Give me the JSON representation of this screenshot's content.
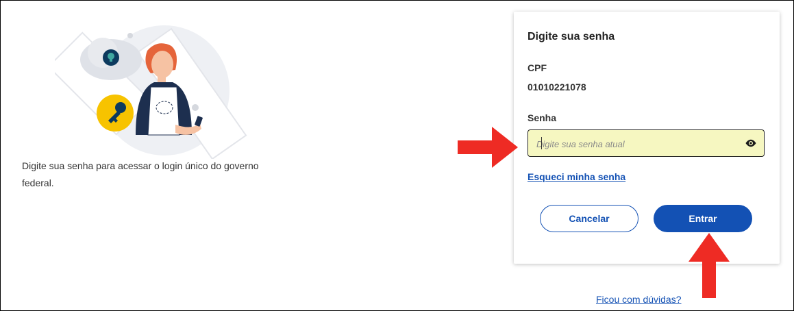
{
  "intro": {
    "description": "Digite sua senha para acessar o login único do governo federal."
  },
  "card": {
    "title": "Digite sua senha",
    "cpf_label": "CPF",
    "cpf_value": "01010221078",
    "password_label": "Senha",
    "password_placeholder": "Digite sua senha atual",
    "password_value": "",
    "forgot_link": "Esqueci minha senha",
    "cancel_label": "Cancelar",
    "enter_label": "Entrar"
  },
  "footer": {
    "help_link": "Ficou com dúvidas?"
  },
  "colors": {
    "primary": "#1351b4",
    "input_bg": "#f6f7c1",
    "annotation_arrow": "#ee2b24",
    "key_badge": "#f7c300"
  },
  "icons": {
    "password_toggle": "eye-icon",
    "illustration_key": "key-icon",
    "illustration_lock": "lock-icon"
  }
}
